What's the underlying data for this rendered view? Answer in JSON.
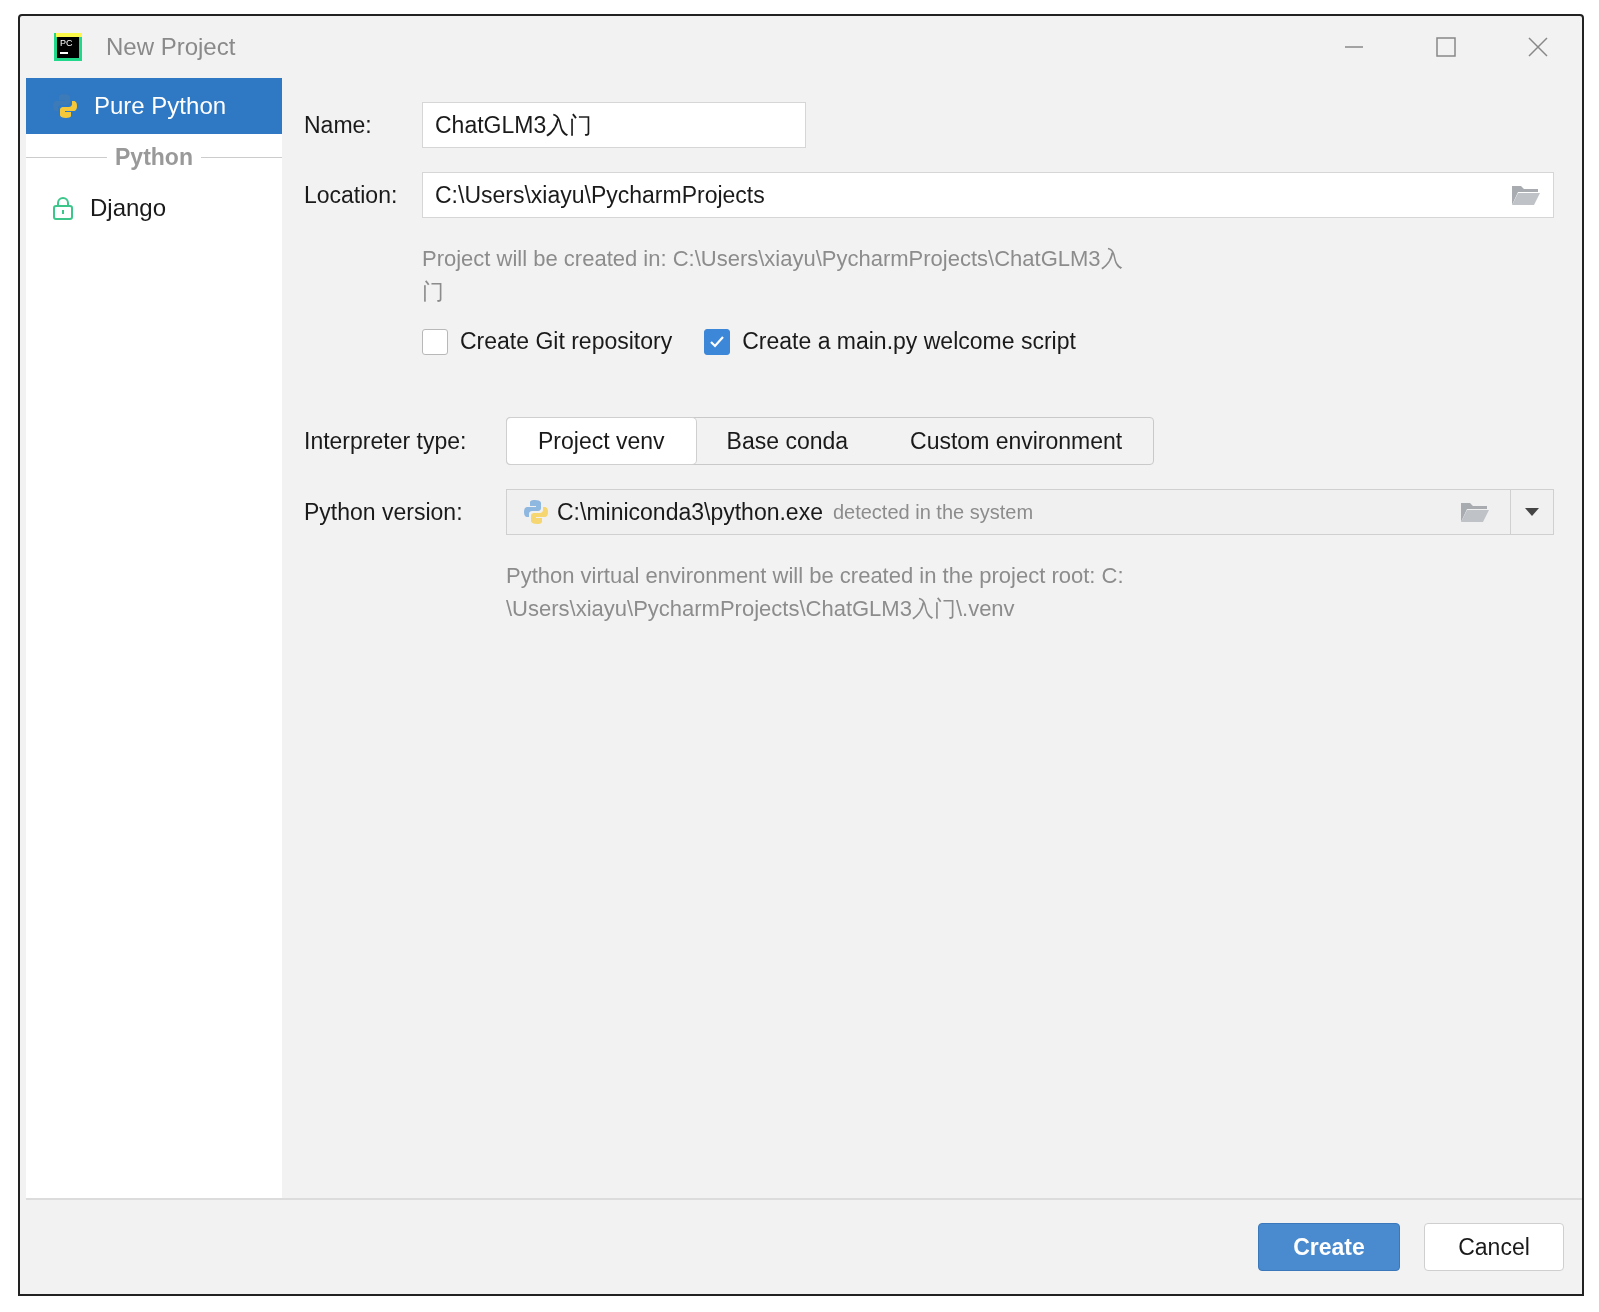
{
  "window": {
    "title": "New Project",
    "logo_text": "PC"
  },
  "sidebar": {
    "items": [
      {
        "label": "Pure Python",
        "kind": "item",
        "selected": true
      },
      {
        "label": "Python",
        "kind": "group"
      },
      {
        "label": "Django",
        "kind": "item",
        "selected": false
      }
    ]
  },
  "name": {
    "label": "Name:",
    "value": "ChatGLM3入门"
  },
  "location": {
    "label": "Location:",
    "value": "C:\\Users\\xiayu\\PycharmProjects"
  },
  "location_hint": {
    "lines": [
      "Project will be created in: C:\\Users\\xiayu\\PycharmProjects\\ChatGLM3入",
      "门"
    ]
  },
  "checkboxes": [
    {
      "label": "Create Git repository",
      "checked": false
    },
    {
      "label": "Create a main.py welcome script",
      "checked": true
    }
  ],
  "interpreter_type": {
    "label": "Interpreter type:",
    "options": [
      {
        "label": "Project venv",
        "selected": true
      },
      {
        "label": "Base conda",
        "selected": false
      },
      {
        "label": "Custom environment",
        "selected": false
      }
    ]
  },
  "python_version": {
    "label": "Python version:",
    "path": "C:\\miniconda3\\python.exe",
    "note": "detected in the system"
  },
  "venv_hint": {
    "lines": [
      "Python virtual environment will be created in the project root: C:",
      "\\Users\\xiayu\\PycharmProjects\\ChatGLM3入门\\.venv"
    ]
  },
  "buttons": [
    {
      "label": "Create",
      "kind": "primary"
    },
    {
      "label": "Cancel",
      "kind": "secondary"
    }
  ]
}
